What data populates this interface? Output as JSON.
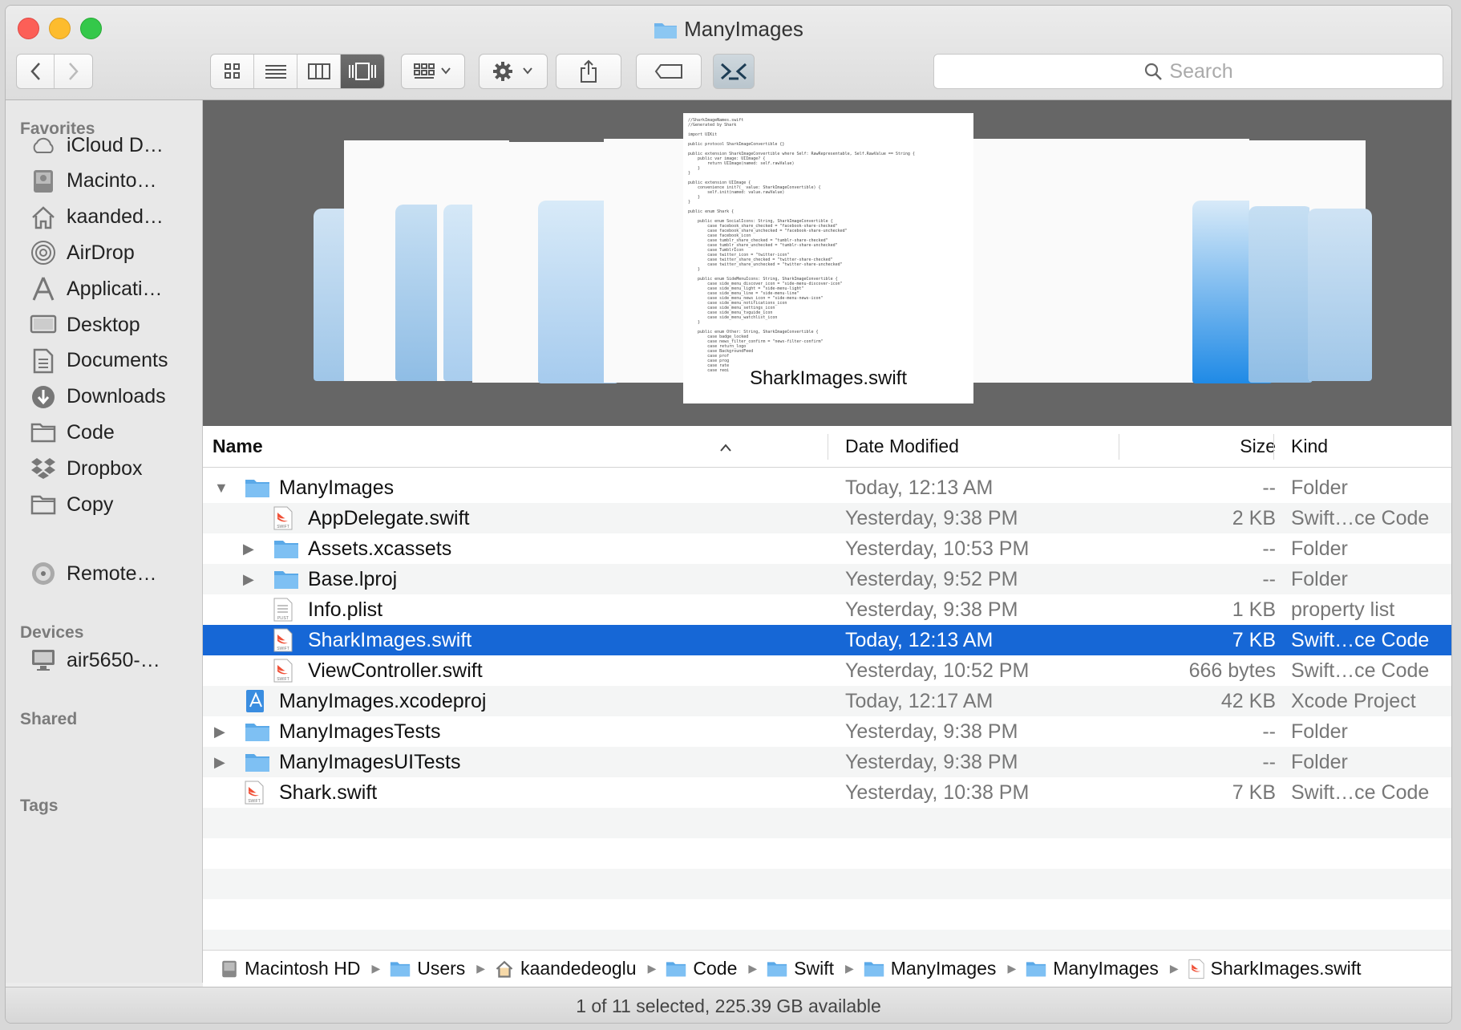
{
  "window": {
    "title": "ManyImages"
  },
  "toolbar": {
    "back_icon": "chevron-left-icon",
    "forward_icon": "chevron-right-icon",
    "view_modes": [
      "icon-view",
      "list-view",
      "column-view",
      "cover-flow-view"
    ],
    "active_view": "cover-flow-view",
    "search_placeholder": "Search"
  },
  "sidebar": {
    "favorites_label": "Favorites",
    "favorites": [
      {
        "label": "iCloud D…",
        "icon": "cloud-icon"
      },
      {
        "label": "Macinto…",
        "icon": "hard-drive-icon"
      },
      {
        "label": "kaanded…",
        "icon": "home-icon"
      },
      {
        "label": "AirDrop",
        "icon": "airdrop-icon"
      },
      {
        "label": "Applicati…",
        "icon": "applications-icon"
      },
      {
        "label": "Desktop",
        "icon": "desktop-icon"
      },
      {
        "label": "Documents",
        "icon": "documents-icon"
      },
      {
        "label": "Downloads",
        "icon": "downloads-icon"
      },
      {
        "label": "Code",
        "icon": "folder-icon"
      },
      {
        "label": "Dropbox",
        "icon": "dropbox-icon"
      },
      {
        "label": "Copy",
        "icon": "folder-icon"
      }
    ],
    "devices_label": "Devices",
    "devices": [
      {
        "label": "Remote…",
        "icon": "disc-icon"
      }
    ],
    "shared_label": "Shared",
    "shared": [
      {
        "label": "air5650-…",
        "icon": "computer-icon"
      }
    ],
    "tags_label": "Tags"
  },
  "coverflow": {
    "caption": "SharkImages.swift"
  },
  "columns": {
    "name": "Name",
    "date": "Date Modified",
    "size": "Size",
    "kind": "Kind"
  },
  "files": [
    {
      "name": "ManyImages",
      "date": "Today, 12:13 AM",
      "size": "--",
      "kind": "Folder",
      "type": "folder",
      "level": 0,
      "disclosure": "open"
    },
    {
      "name": "AppDelegate.swift",
      "date": "Yesterday, 9:38 PM",
      "size": "2 KB",
      "kind": "Swift…ce Code",
      "type": "swift",
      "level": 1,
      "disclosure": "none"
    },
    {
      "name": "Assets.xcassets",
      "date": "Yesterday, 10:53 PM",
      "size": "--",
      "kind": "Folder",
      "type": "folder",
      "level": 1,
      "disclosure": "closed"
    },
    {
      "name": "Base.lproj",
      "date": "Yesterday, 9:52 PM",
      "size": "--",
      "kind": "Folder",
      "type": "folder",
      "level": 1,
      "disclosure": "closed"
    },
    {
      "name": "Info.plist",
      "date": "Yesterday, 9:38 PM",
      "size": "1 KB",
      "kind": "property list",
      "type": "plist",
      "level": 1,
      "disclosure": "none"
    },
    {
      "name": "SharkImages.swift",
      "date": "Today, 12:13 AM",
      "size": "7 KB",
      "kind": "Swift…ce Code",
      "type": "swift",
      "level": 1,
      "disclosure": "none",
      "selected": true
    },
    {
      "name": "ViewController.swift",
      "date": "Yesterday, 10:52 PM",
      "size": "666 bytes",
      "kind": "Swift…ce Code",
      "type": "swift",
      "level": 1,
      "disclosure": "none"
    },
    {
      "name": "ManyImages.xcodeproj",
      "date": "Today, 12:17 AM",
      "size": "42 KB",
      "kind": "Xcode Project",
      "type": "xcodeproj",
      "level": 0,
      "disclosure": "none"
    },
    {
      "name": "ManyImagesTests",
      "date": "Yesterday, 9:38 PM",
      "size": "--",
      "kind": "Folder",
      "type": "folder",
      "level": 0,
      "disclosure": "closed"
    },
    {
      "name": "ManyImagesUITests",
      "date": "Yesterday, 9:38 PM",
      "size": "--",
      "kind": "Folder",
      "type": "folder",
      "level": 0,
      "disclosure": "closed"
    },
    {
      "name": "Shark.swift",
      "date": "Yesterday, 10:38 PM",
      "size": "7 KB",
      "kind": "Swift…ce Code",
      "type": "swift",
      "level": 0,
      "disclosure": "none"
    }
  ],
  "pathbar": [
    {
      "label": "Macintosh HD",
      "icon": "hard-drive-icon"
    },
    {
      "label": "Users",
      "icon": "folder-icon"
    },
    {
      "label": "kaandedeoglu",
      "icon": "home-icon"
    },
    {
      "label": "Code",
      "icon": "folder-icon"
    },
    {
      "label": "Swift",
      "icon": "folder-icon"
    },
    {
      "label": "ManyImages",
      "icon": "folder-icon"
    },
    {
      "label": "ManyImages",
      "icon": "folder-icon"
    },
    {
      "label": "SharkImages.swift",
      "icon": "swift-file-icon"
    }
  ],
  "status": "1 of 11 selected, 225.39 GB available",
  "colors": {
    "selection": "#1667d6",
    "folder": "#6fb4ec",
    "swift": "#f05138"
  }
}
